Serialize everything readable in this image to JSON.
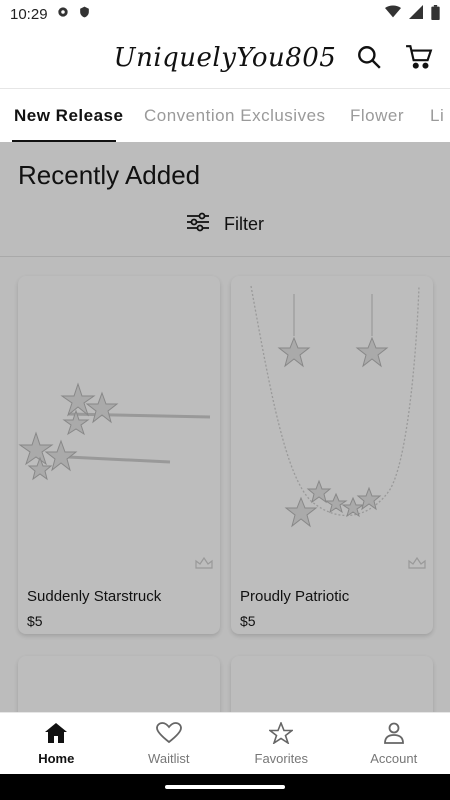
{
  "status_bar": {
    "time": "10:29",
    "icons": [
      "settings-icon",
      "shield-icon",
      "wifi-icon",
      "signal-icon",
      "battery-icon"
    ]
  },
  "header": {
    "logo_text": "UniquelyYou805",
    "icons": [
      "search-icon",
      "cart-icon"
    ]
  },
  "tabs": [
    {
      "label": "New Release",
      "active": true
    },
    {
      "label": "Convention Exclusives",
      "active": false
    },
    {
      "label": "Flower",
      "active": false
    },
    {
      "label": "Li",
      "active": false
    }
  ],
  "main": {
    "section_title": "Recently Added",
    "filter_label": "Filter"
  },
  "products": [
    {
      "title": "Suddenly Starstruck",
      "price": "$5"
    },
    {
      "title": "Proudly Patriotic",
      "price": "$5"
    }
  ],
  "bottom_nav": [
    {
      "label": "Home",
      "icon": "home-icon",
      "active": true
    },
    {
      "label": "Waitlist",
      "icon": "heart-icon",
      "active": false
    },
    {
      "label": "Favorites",
      "icon": "star-icon",
      "active": false
    },
    {
      "label": "Account",
      "icon": "account-icon",
      "active": false
    }
  ],
  "colors": {
    "overlay": "#bdbdbd",
    "active_text": "#111111",
    "inactive_text": "#9a9a9a"
  }
}
